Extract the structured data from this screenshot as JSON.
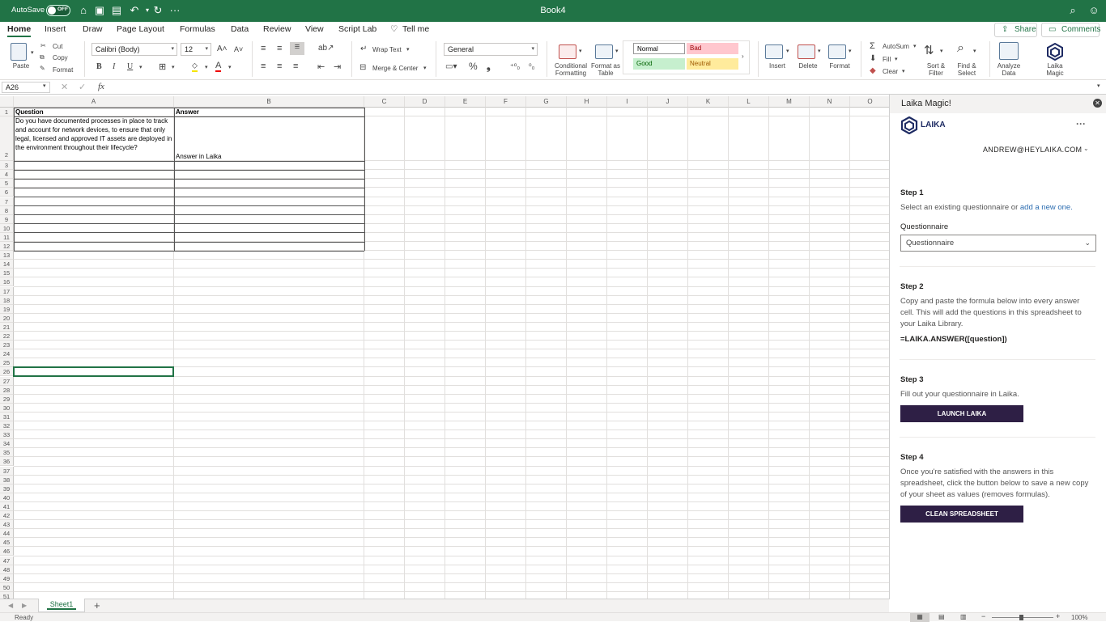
{
  "titlebar": {
    "autosave_label": "AutoSave",
    "autosave_state": "OFF",
    "doc_title": "Book4"
  },
  "tabs": [
    "Home",
    "Insert",
    "Draw",
    "Page Layout",
    "Formulas",
    "Data",
    "Review",
    "View",
    "Script Lab",
    "Tell me"
  ],
  "share_label": "Share",
  "comments_label": "Comments",
  "ribbon": {
    "paste": "Paste",
    "cut": "Cut",
    "copy": "Copy",
    "format_painter": "Format",
    "font_name": "Calibri (Body)",
    "font_size": "12",
    "bold": "B",
    "italic": "I",
    "underline": "U",
    "wrap_text": "Wrap Text",
    "merge_center": "Merge & Center",
    "number_format": "General",
    "conditional_formatting": "Conditional Formatting",
    "format_as_table": "Format as Table",
    "styles": {
      "normal": "Normal",
      "bad": "Bad",
      "good": "Good",
      "neutral": "Neutral"
    },
    "insert": "Insert",
    "delete": "Delete",
    "format": "Format",
    "autosum": "AutoSum",
    "fill": "Fill",
    "clear": "Clear",
    "sort_filter": "Sort & Filter",
    "find_select": "Find & Select",
    "analyze_data": "Analyze Data",
    "laika_magic": "Laika Magic"
  },
  "formula_bar": {
    "name_box": "A26",
    "fx": "fx",
    "content": ""
  },
  "columns": [
    "A",
    "B",
    "C",
    "D",
    "E",
    "F",
    "G",
    "H",
    "I",
    "J",
    "K",
    "L",
    "M",
    "N",
    "O"
  ],
  "cells": {
    "a1": "Question",
    "b1": "Answer",
    "a2": "Do you have documented processes in place to track and account for network devices, to ensure that only legal, licensed and approved IT assets are deployed in the environment throughout their lifecycle?",
    "b2": "Answer in Laika"
  },
  "taskpane": {
    "title": "Laika Magic!",
    "brand": "LAIKA",
    "more": "···",
    "account": "ANDREW@HEYLAIKA.COM",
    "step1_title": "Step 1",
    "step1_text": "Select an existing questionnaire or",
    "step1_link": "add a new one.",
    "questionnaire_label": "Questionnaire",
    "questionnaire_value": "Questionnaire",
    "step2_title": "Step 2",
    "step2_text": "Copy and paste the formula below into every answer cell. This will add the questions in this spreadsheet to your Laika Library.",
    "step2_formula": "=LAIKA.ANSWER([question])",
    "step3_title": "Step 3",
    "step3_text": "Fill out your questionnaire in Laika.",
    "launch_button": "LAUNCH LAIKA",
    "step4_title": "Step 4",
    "step4_text": "Once you're satisfied with the answers in this spreadsheet, click the button below to save a new copy of your sheet as values (removes formulas).",
    "clean_button": "CLEAN SPREADSHEET"
  },
  "sheet_tab": "Sheet1",
  "status": {
    "ready": "Ready",
    "zoom": "100%"
  },
  "colors": {
    "accent": "#217346",
    "laika_button": "#2e1f45",
    "link": "#2b6cb0"
  }
}
